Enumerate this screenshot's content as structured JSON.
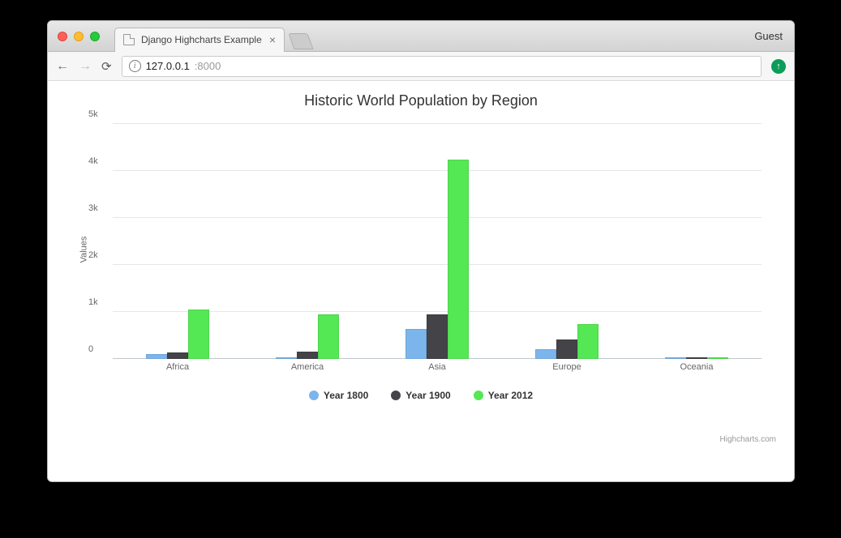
{
  "browser": {
    "tab_title": "Django Highcharts Example",
    "guest_label": "Guest",
    "url_host": "127.0.0.1",
    "url_port": ":8000"
  },
  "chart": {
    "title": "Historic World Population by Region",
    "ylabel": "Values",
    "credit": "Highcharts.com"
  },
  "yticks": [
    "0",
    "1k",
    "2k",
    "3k",
    "4k",
    "5k"
  ],
  "legend": [
    {
      "label": "Year 1800",
      "color": "#7cb5ec"
    },
    {
      "label": "Year 1900",
      "color": "#434348"
    },
    {
      "label": "Year 2012",
      "color": "#54e854"
    }
  ],
  "colors": {
    "s1": "#7cb5ec",
    "s2": "#434348",
    "s3": "#54e854"
  },
  "chart_data": {
    "type": "bar",
    "title": "Historic World Population by Region",
    "xlabel": "",
    "ylabel": "Values",
    "ylim": [
      0,
      5000
    ],
    "categories": [
      "Africa",
      "America",
      "Asia",
      "Europe",
      "Oceania"
    ],
    "series": [
      {
        "name": "Year 1800",
        "values": [
          107,
          31,
          635,
          203,
          2
        ]
      },
      {
        "name": "Year 1900",
        "values": [
          133,
          156,
          947,
          408,
          6
        ]
      },
      {
        "name": "Year 2012",
        "values": [
          1052,
          954,
          4250,
          740,
          38
        ]
      }
    ]
  }
}
